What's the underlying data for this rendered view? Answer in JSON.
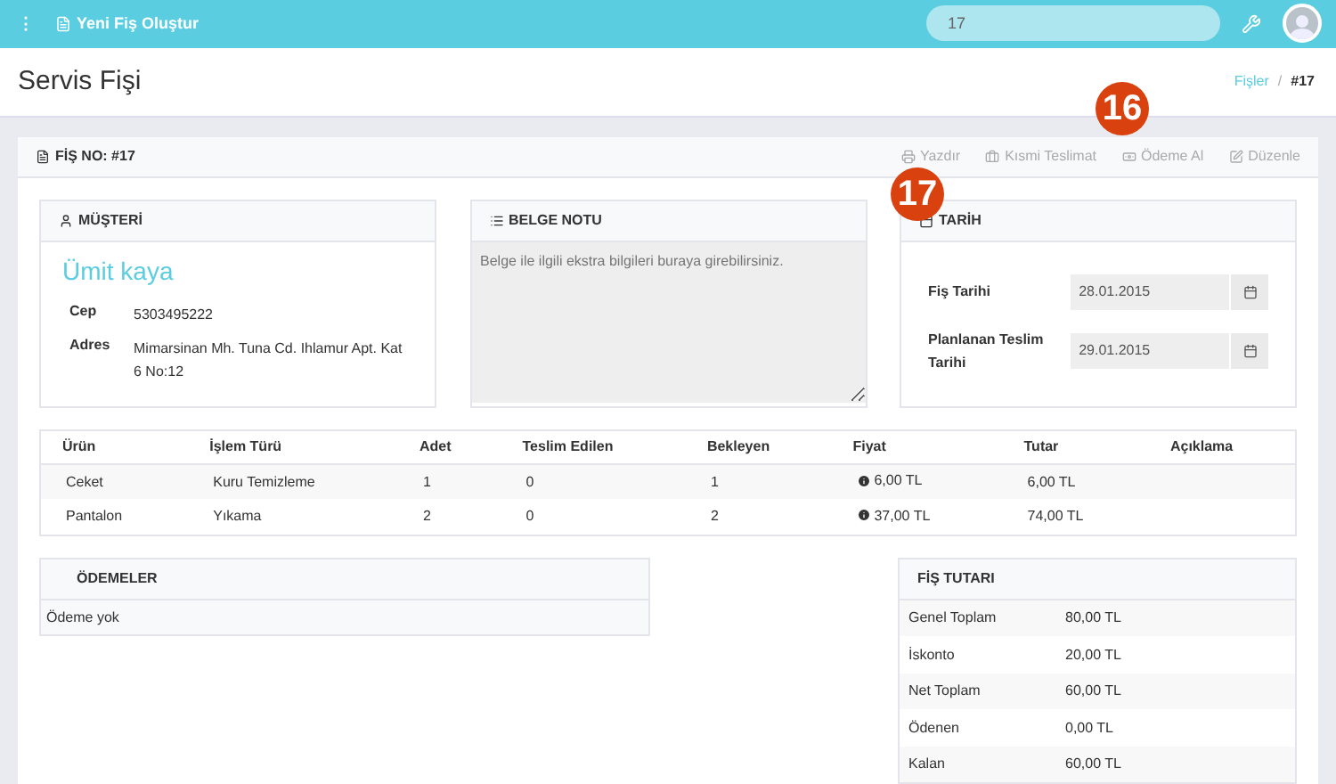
{
  "topbar": {
    "menu_icon": "⋮",
    "title": "Yeni Fiş Oluştur",
    "search_value": "17"
  },
  "header": {
    "title": "Servis Fişi",
    "separator": "/",
    "breadcrumb": [
      {
        "label": "Fişler",
        "link": true
      },
      {
        "label": "#17",
        "link": false
      }
    ]
  },
  "callouts": [
    {
      "label": "16",
      "kind": "actions"
    },
    {
      "label": "17",
      "kind": "date"
    }
  ],
  "panel": {
    "title": "FİŞ NO: #17",
    "actions": [
      {
        "label": "Yazdır",
        "kind": "print"
      },
      {
        "label": "Kısmi Teslimat",
        "kind": "delivery"
      },
      {
        "label": "Ödeme Al",
        "kind": "payment"
      },
      {
        "label": "Düzenle",
        "kind": "edit"
      }
    ]
  },
  "customer": {
    "title": "MÜŞTERİ",
    "name": "Ümit kaya",
    "fields": [
      {
        "label": "Cep",
        "value": "5303495222"
      },
      {
        "label": "Adres",
        "value": "Mimarsinan Mh. Tuna Cd. Ihlamur Apt. Kat 6 No:12"
      }
    ]
  },
  "note": {
    "title": "BELGE NOTU",
    "placeholder": "Belge ile ilgili ekstra bilgileri buraya girebilirsiniz."
  },
  "dates": {
    "title": "TARİH",
    "fields": [
      {
        "label": "Fiş Tarihi",
        "value": "28.01.2015"
      },
      {
        "label": "Planlanan Teslim Tarihi",
        "value": "29.01.2015"
      }
    ]
  },
  "table": {
    "columns": [
      "Ürün",
      "İşlem Türü",
      "Adet",
      "Teslim Edilen",
      "Bekleyen",
      "Fiyat",
      "Tutar",
      "Açıklama"
    ],
    "rows": [
      [
        "Ceket",
        "Kuru Temizleme",
        "1",
        "0",
        "1",
        "6,00 TL",
        "6,00 TL",
        ""
      ],
      [
        "Pantalon",
        "Yıkama",
        "2",
        "0",
        "2",
        "37,00 TL",
        "74,00 TL",
        ""
      ]
    ]
  },
  "payments": {
    "title": "ÖDEMELER",
    "empty": "Ödeme yok"
  },
  "totals": {
    "title": "FİŞ TUTARI",
    "rows": [
      {
        "label": "Genel Toplam",
        "value": "80,00 TL"
      },
      {
        "label": "İskonto",
        "value": "20,00 TL"
      },
      {
        "label": "Net Toplam",
        "value": "60,00 TL"
      },
      {
        "label": "Ödenen",
        "value": "0,00 TL"
      },
      {
        "label": "Kalan",
        "value": "60,00 TL"
      }
    ]
  }
}
